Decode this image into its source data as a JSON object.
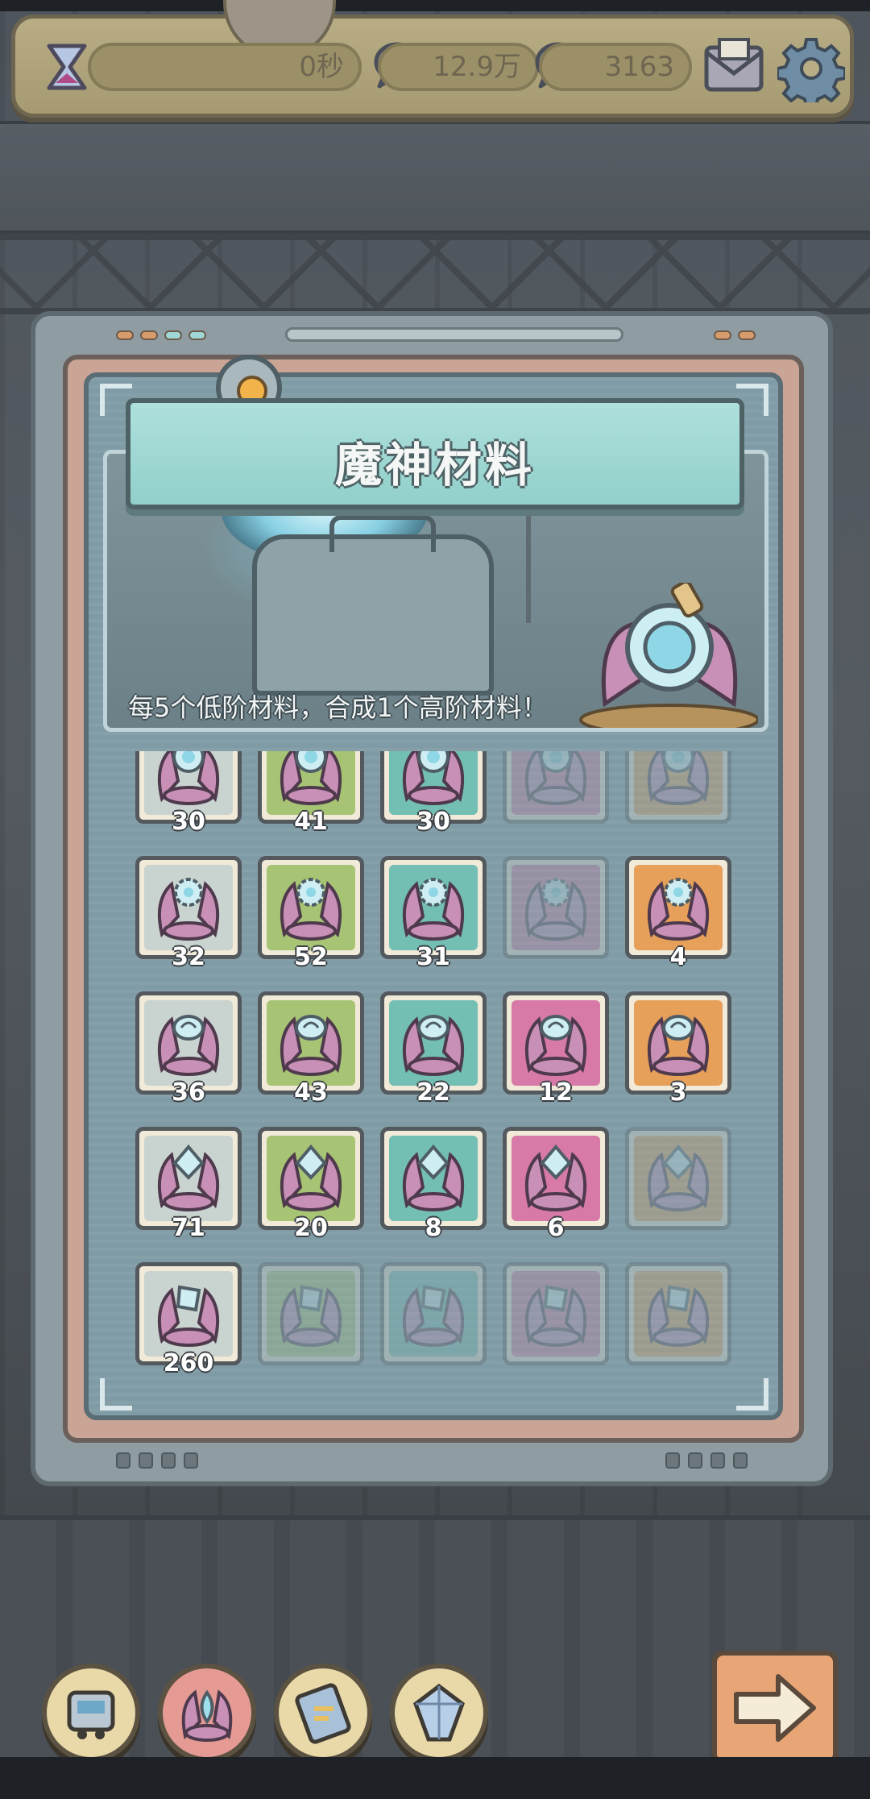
{
  "hud": {
    "timer_value": "0秒",
    "coins_value": "12.9万",
    "gems_value": "3163",
    "icons": [
      "hourglass-icon",
      "coin-bubble-icon",
      "gem-bubble-icon",
      "mail-icon",
      "gear-icon"
    ]
  },
  "panel": {
    "title": "魔神材料",
    "hint": "每5个低阶材料，合成1个高阶材料！"
  },
  "colors": {
    "grey_tile": "#c9d3cf",
    "green_tile": "#a7c474",
    "teal_tile": "#73bfb3",
    "pink_tile": "#d77aa8",
    "orange_tile": "#e6a05a",
    "frame_bg": "#8f9da3",
    "title_plate": "#aee0dc"
  },
  "materials": {
    "rows": [
      {
        "name": "ring-material",
        "cells": [
          {
            "tier": "grey",
            "count": "30",
            "owned": true
          },
          {
            "tier": "green",
            "count": "41",
            "owned": true
          },
          {
            "tier": "teal",
            "count": "30",
            "owned": true
          },
          {
            "tier": "pink",
            "count": "",
            "owned": false
          },
          {
            "tier": "orange",
            "count": "",
            "owned": false
          }
        ]
      },
      {
        "name": "gear-material",
        "cells": [
          {
            "tier": "grey",
            "count": "32",
            "owned": true
          },
          {
            "tier": "green",
            "count": "52",
            "owned": true
          },
          {
            "tier": "teal",
            "count": "31",
            "owned": true
          },
          {
            "tier": "pink",
            "count": "",
            "owned": false
          },
          {
            "tier": "orange",
            "count": "4",
            "owned": true
          }
        ]
      },
      {
        "name": "orb-material",
        "cells": [
          {
            "tier": "grey",
            "count": "36",
            "owned": true
          },
          {
            "tier": "green",
            "count": "43",
            "owned": true
          },
          {
            "tier": "teal",
            "count": "22",
            "owned": true
          },
          {
            "tier": "pink",
            "count": "12",
            "owned": true
          },
          {
            "tier": "orange",
            "count": "3",
            "owned": true
          }
        ]
      },
      {
        "name": "crystal-material",
        "cells": [
          {
            "tier": "grey",
            "count": "71",
            "owned": true
          },
          {
            "tier": "green",
            "count": "20",
            "owned": true
          },
          {
            "tier": "teal",
            "count": "8",
            "owned": true
          },
          {
            "tier": "pink",
            "count": "6",
            "owned": true
          },
          {
            "tier": "orange",
            "count": "",
            "owned": false
          }
        ]
      },
      {
        "name": "shard-material",
        "cells": [
          {
            "tier": "grey",
            "count": "260",
            "owned": true
          },
          {
            "tier": "green",
            "count": "",
            "owned": false
          },
          {
            "tier": "teal",
            "count": "",
            "owned": false
          },
          {
            "tier": "pink",
            "count": "",
            "owned": false
          },
          {
            "tier": "orange",
            "count": "",
            "owned": false
          }
        ]
      }
    ]
  },
  "bottom_nav": {
    "items": [
      {
        "name": "nav-machine",
        "icon": "machine-icon",
        "active": false
      },
      {
        "name": "nav-demon-materials",
        "icon": "demon-material-icon",
        "active": true
      },
      {
        "name": "nav-blueprint",
        "icon": "blueprint-icon",
        "active": false
      },
      {
        "name": "nav-crystal",
        "icon": "crystal-icon",
        "active": false
      }
    ],
    "next_icon": "arrow-right-icon"
  }
}
